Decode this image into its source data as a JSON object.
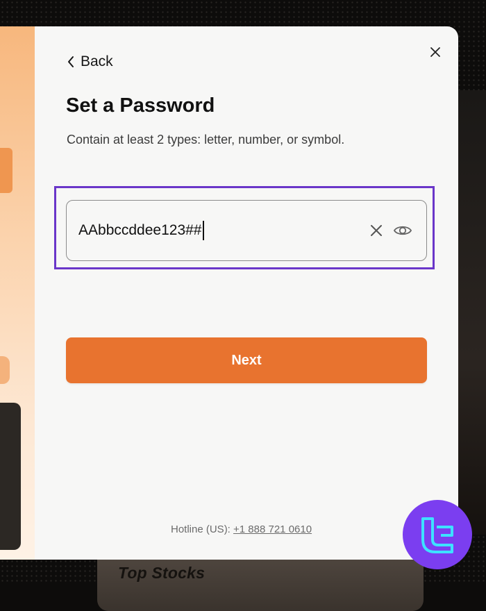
{
  "nav": {
    "back_label": "Back"
  },
  "form": {
    "title": "Set a Password",
    "subtitle": "Contain at least 2 types: letter, number, or symbol.",
    "password_value": "AAbbccddee123##",
    "next_label": "Next"
  },
  "footer": {
    "hotline_label": "Hotline (US):",
    "hotline_number": "+1 888 721 0610"
  },
  "background": {
    "card_label": "Top Stocks"
  },
  "icons": {
    "close": "close-icon",
    "back": "chevron-left-icon",
    "clear": "clear-icon",
    "visibility": "eye-icon",
    "logo": "tc-logo-icon"
  },
  "colors": {
    "accent": "#e8732f",
    "highlight": "#6a36c9",
    "logo_bg": "#7b3ef0",
    "logo_fg": "#3de1ff"
  }
}
